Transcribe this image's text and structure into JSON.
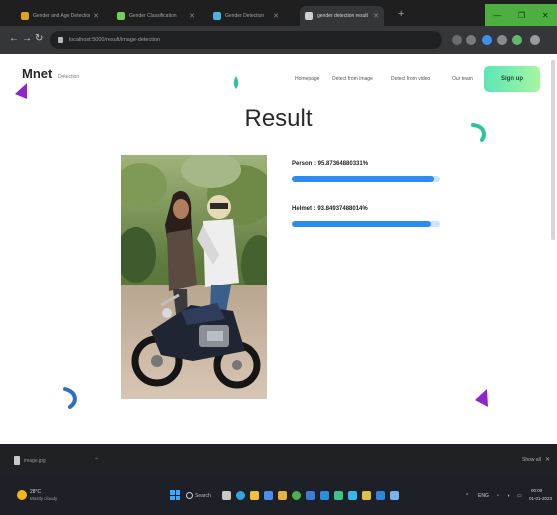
{
  "browser": {
    "tabs": [
      {
        "label": "Gender and Age Detection",
        "fav": "#e0a020"
      },
      {
        "label": "Gender Classification",
        "fav": "#6fcf5a"
      },
      {
        "label": "Gender Detection",
        "fav": "#49b6e0"
      },
      {
        "label": "gender detection result",
        "fav": "#d0d0d0",
        "active": true
      }
    ],
    "new_tab": "+",
    "url": "localhost:5000/result/image-detection",
    "window_controls": [
      "—",
      "❐",
      "✕"
    ]
  },
  "page": {
    "logo": "Mnet",
    "logo_sub": "Detection",
    "nav": [
      "Homepage",
      "Detect from image",
      "Detect from video",
      "Our team"
    ],
    "cta": "Sign up",
    "title": "Result",
    "results": [
      {
        "label": "Person : 95.87364880331%",
        "percent": 95.87
      },
      {
        "label": "Helmet : 93.84937488014%",
        "percent": 93.85
      }
    ]
  },
  "downloads": {
    "file": "image.jpg",
    "show_all": "Show all"
  },
  "taskbar": {
    "weather_temp": "28°C",
    "weather_desc": "Mostly cloudy",
    "search": "Search",
    "lang": "ENG",
    "time": "00:00",
    "date": "01-01-2023"
  },
  "colors": {
    "accent": "#2d8cf0",
    "cta_gradient_start": "#5be6b8",
    "cta_gradient_end": "#a6f5a0",
    "decor_purple": "#8e24c9",
    "decor_teal": "#2ec3a0",
    "decor_blue": "#2d6fc8"
  }
}
